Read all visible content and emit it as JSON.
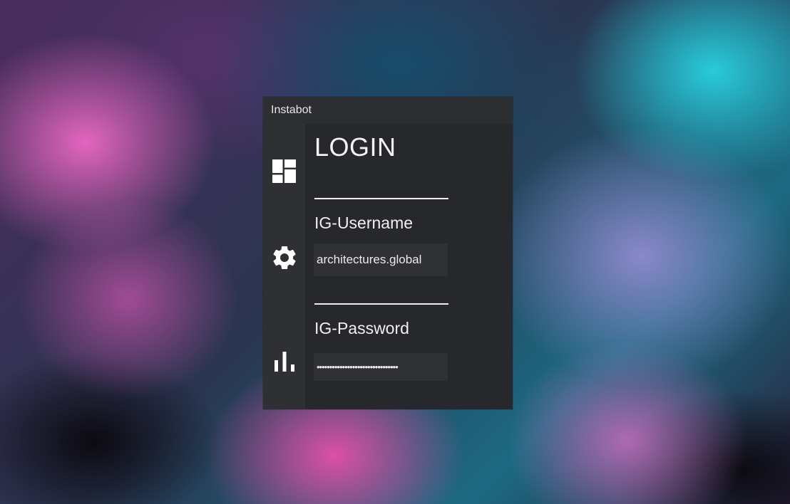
{
  "window": {
    "title": "Instabot"
  },
  "sidebar": {
    "items": [
      {
        "name": "dashboard",
        "icon": "dashboard-icon"
      },
      {
        "name": "settings",
        "icon": "gear-icon"
      },
      {
        "name": "statistics",
        "icon": "bar-chart-icon"
      }
    ]
  },
  "login": {
    "title": "LOGIN",
    "username_label": "IG-Username",
    "username_value": "architectures.global",
    "password_label": "IG-Password",
    "password_value": "••••••••••••••••••••••••••••••••"
  },
  "colors": {
    "window_bg": "#27282c",
    "sidebar_bg": "#2f3034",
    "titlebar_bg": "#2d2e32",
    "input_bg": "#303135",
    "text": "#f0f0f0"
  }
}
